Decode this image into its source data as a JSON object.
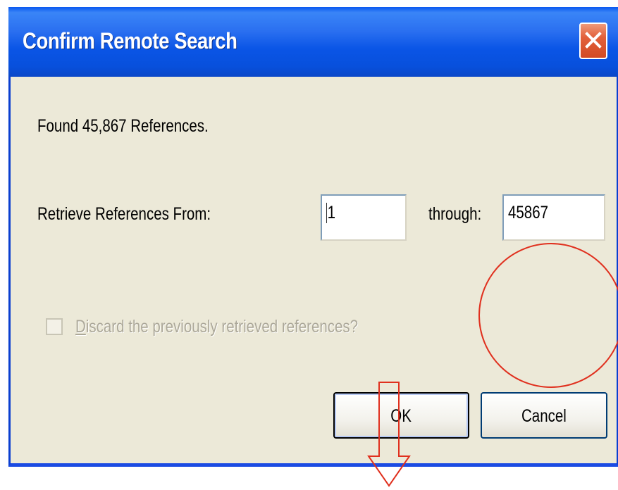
{
  "dialog": {
    "title": "Confirm Remote Search",
    "close_icon": "close-x-icon"
  },
  "message": "Found 45,867 References.",
  "range": {
    "from_label": "Retrieve References From:",
    "from_value": "1",
    "through_label": "through:",
    "through_value": "45867"
  },
  "discard": {
    "label_first": "D",
    "label_rest": "iscard the previously retrieved references?",
    "checked": false,
    "enabled": false
  },
  "buttons": {
    "ok": "OK",
    "cancel": "Cancel"
  },
  "annotations": {
    "color": "#e0301e",
    "circle_icon": "highlight-circle",
    "arrow_icon": "down-arrow"
  }
}
